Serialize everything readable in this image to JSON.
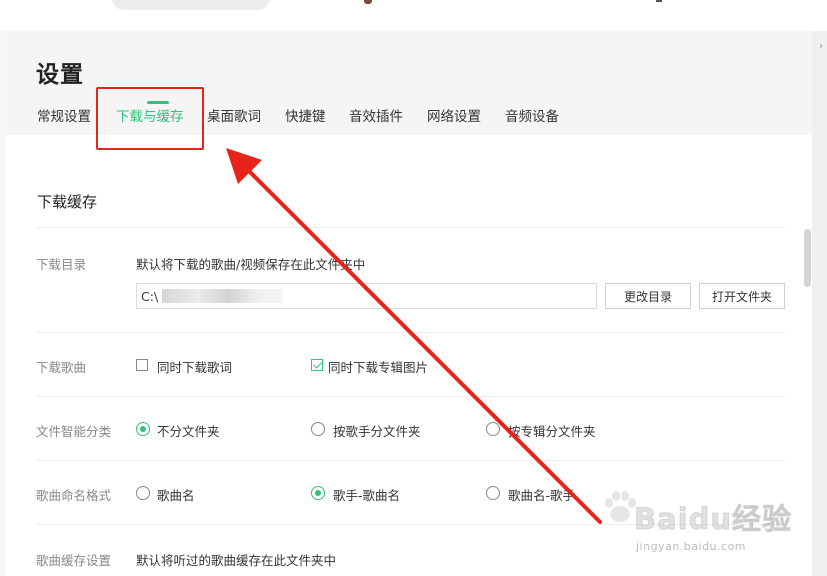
{
  "page_title": "设置",
  "tabs": [
    {
      "label": "常规设置",
      "active": false
    },
    {
      "label": "下载与缓存",
      "active": true
    },
    {
      "label": "桌面歌词",
      "active": false
    },
    {
      "label": "快捷键",
      "active": false
    },
    {
      "label": "音效插件",
      "active": false
    },
    {
      "label": "网络设置",
      "active": false
    },
    {
      "label": "音频设备",
      "active": false
    }
  ],
  "section_title": "下载缓存",
  "download_dir": {
    "label": "下载目录",
    "description": "默认将下载的歌曲/视频保存在此文件夹中",
    "path_value": "C:\\",
    "change_button": "更改目录",
    "open_button": "打开文件夹"
  },
  "download_songs": {
    "label": "下载歌曲",
    "options": [
      {
        "label": "同时下载歌词",
        "checked": false
      },
      {
        "label": "同时下载专辑图片",
        "checked": true
      }
    ]
  },
  "smart_classify": {
    "label": "文件智能分类",
    "options": [
      {
        "label": "不分文件夹",
        "selected": true
      },
      {
        "label": "按歌手分文件夹",
        "selected": false
      },
      {
        "label": "按专辑分文件夹",
        "selected": false
      }
    ]
  },
  "naming_format": {
    "label": "歌曲命名格式",
    "options": [
      {
        "label": "歌曲名",
        "selected": false
      },
      {
        "label": "歌手-歌曲名",
        "selected": true
      },
      {
        "label": "歌曲名-歌手",
        "selected": false
      }
    ]
  },
  "cache_settings": {
    "label": "歌曲缓存设置",
    "description": "默认将听过的歌曲缓存在此文件夹中"
  },
  "watermark": {
    "brand": "Baidu经验",
    "url": "jingyan.baidu.com"
  },
  "colors": {
    "accent": "#31c27c",
    "annotation": "#e8231a"
  }
}
